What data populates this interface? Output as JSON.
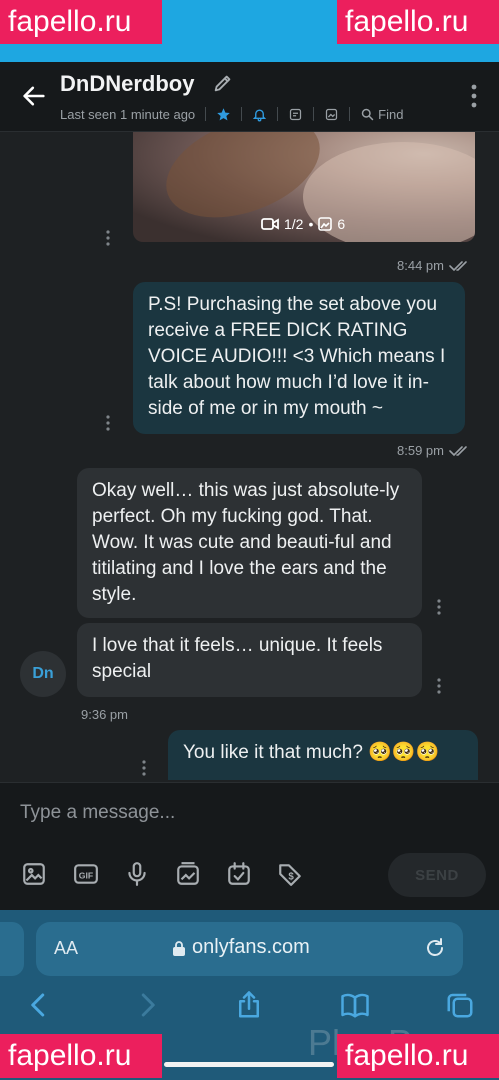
{
  "watermark": "fapello.ru",
  "header": {
    "name": "DnDNerdboy",
    "last_seen": "Last seen 1 minute ago",
    "find_label": "Find"
  },
  "media": {
    "video_count": "1/2",
    "photo_count": "6"
  },
  "messages": [
    {
      "direction": "outgoing",
      "time": "8:44 pm"
    },
    {
      "direction": "outgoing",
      "text": "P.S! Purchasing the set above you receive a FREE DICK RATING VOICE AUDIO!!! <3 Which means I talk about how much I’d love it in-side of me or in my mouth ~",
      "time": "8:59 pm"
    },
    {
      "direction": "incoming",
      "text": "Okay well… this was just absolute-ly perfect. Oh my fucking god. That. Wow. It was cute and beauti-ful and titilating and I love the ears and the style."
    },
    {
      "direction": "incoming",
      "text": "I love that it feels… unique. It feels special",
      "time": "9:36 pm"
    },
    {
      "direction": "outgoing",
      "text": "You like it that much? 🥺🥺🥺"
    }
  ],
  "avatar_initials": "Dn",
  "composer": {
    "placeholder": "Type a message...",
    "send_label": "SEND"
  },
  "browser": {
    "aa_label": "AA",
    "url": "onlyfans.com"
  },
  "ghost_text": "Plus P",
  "colors": {
    "accent": "#1ea7e1",
    "outgoing_bubble": "#1b3640",
    "incoming_bubble": "#2d3134",
    "watermark": "#ec1f5d",
    "browser_bar": "#1f5a79"
  }
}
